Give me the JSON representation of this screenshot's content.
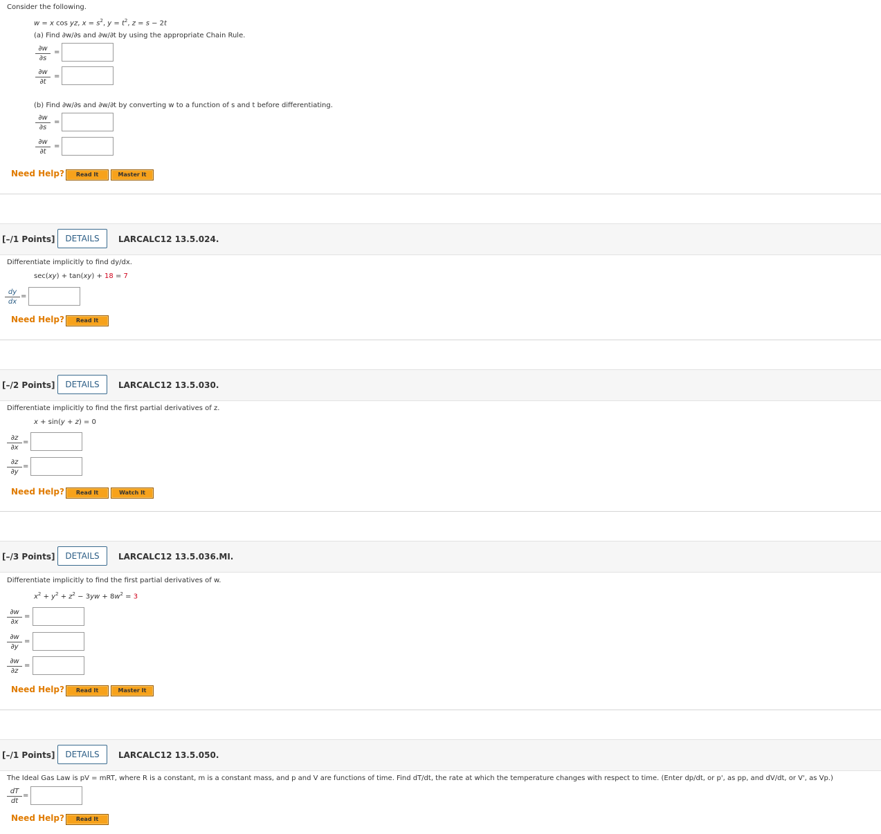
{
  "help": {
    "need_help": "Need Help?",
    "read_it": "Read It",
    "master_it": "Master It",
    "watch_it": "Watch It"
  },
  "details_label": "DETAILS",
  "q1": {
    "intro": "Consider the following.",
    "part_a": "(a) Find ∂w/∂s and ∂w/∂t by using the appropriate Chain Rule.",
    "part_b": "(b) Find ∂w/∂s and ∂w/∂t by converting w to a function of s and t before differentiating."
  },
  "q2": {
    "points": "[–/1 Points]",
    "id": "LARCALC12 13.5.024.",
    "prompt": "Differentiate implicitly to find dy/dx."
  },
  "q3": {
    "points": "[–/2 Points]",
    "id": "LARCALC12 13.5.030.",
    "prompt": "Differentiate implicitly to find the first partial derivatives of z."
  },
  "q4": {
    "points": "[–/3 Points]",
    "id": "LARCALC12 13.5.036.MI.",
    "prompt": "Differentiate implicitly to find the first partial derivatives of w."
  },
  "q5": {
    "points": "[–/1 Points]",
    "id": "LARCALC12 13.5.050.",
    "prompt": "The Ideal Gas Law is pV = mRT, where R is a constant, m is a constant mass, and p and V are functions of time. Find dT/dt, the rate at which the temperature changes with respect to time. (Enter dp/dt, or p', as pp, and dV/dt, or V', as Vp.)"
  },
  "colors": {
    "accent": "#e07b00",
    "highlight": "#d0021b",
    "details_border": "#3a6b8f"
  }
}
